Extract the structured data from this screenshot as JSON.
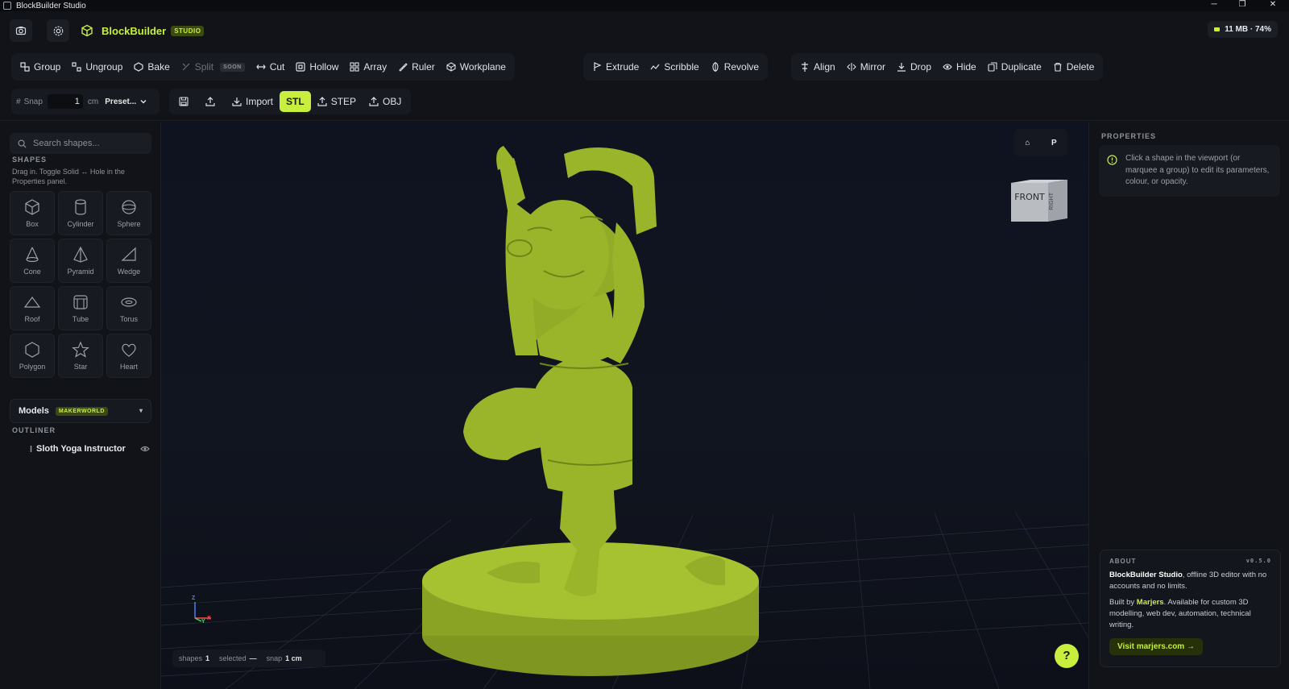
{
  "window": {
    "title": "BlockBuilder Studio",
    "controls": [
      "─",
      "❐",
      "✕"
    ]
  },
  "header": {
    "brand_name": "BlockBuilder",
    "brand_badge": "STUDIO",
    "memory": "11 MB · 74%",
    "accent_color": "#c8ef3e"
  },
  "toolbar": {
    "group1": [
      {
        "label": "Group",
        "icon": "group-icon"
      },
      {
        "label": "Ungroup",
        "icon": "ungroup-icon"
      },
      {
        "label": "Bake",
        "icon": "bake-icon"
      },
      {
        "label": "Split",
        "icon": "split-icon",
        "badge": "SOON",
        "disabled": true
      },
      {
        "label": "Cut",
        "icon": "cut-icon"
      },
      {
        "label": "Hollow",
        "icon": "hollow-icon"
      },
      {
        "label": "Array",
        "icon": "array-icon"
      },
      {
        "label": "Ruler",
        "icon": "ruler-icon"
      },
      {
        "label": "Workplane",
        "icon": "workplane-icon"
      }
    ],
    "group2": [
      {
        "label": "Extrude",
        "icon": "extrude-icon"
      },
      {
        "label": "Scribble",
        "icon": "scribble-icon"
      },
      {
        "label": "Revolve",
        "icon": "revolve-icon"
      }
    ],
    "group3": [
      {
        "label": "Align",
        "icon": "align-icon"
      },
      {
        "label": "Mirror",
        "icon": "mirror-icon"
      },
      {
        "label": "Drop",
        "icon": "drop-icon"
      },
      {
        "label": "Hide",
        "icon": "hide-icon"
      },
      {
        "label": "Duplicate",
        "icon": "duplicate-icon"
      },
      {
        "label": "Delete",
        "icon": "delete-icon"
      }
    ]
  },
  "snap": {
    "label": "Snap",
    "value": "1",
    "unit": "cm",
    "preset": "Preset..."
  },
  "file": {
    "import": "Import",
    "formats": [
      "STL",
      "STEP",
      "OBJ"
    ],
    "active_format": "STL"
  },
  "sidebar": {
    "search_placeholder": "Search shapes...",
    "shapes_title": "SHAPES",
    "shapes_hint": "Drag in. Toggle Solid ↔ Hole in the Properties panel.",
    "shapes": [
      {
        "label": "Box",
        "icon": "box-icon"
      },
      {
        "label": "Cylinder",
        "icon": "cylinder-icon"
      },
      {
        "label": "Sphere",
        "icon": "sphere-icon"
      },
      {
        "label": "Cone",
        "icon": "cone-icon"
      },
      {
        "label": "Pyramid",
        "icon": "pyramid-icon"
      },
      {
        "label": "Wedge",
        "icon": "wedge-icon"
      },
      {
        "label": "Roof",
        "icon": "roof-icon"
      },
      {
        "label": "Tube",
        "icon": "tube-icon"
      },
      {
        "label": "Torus",
        "icon": "torus-icon"
      },
      {
        "label": "Polygon",
        "icon": "polygon-icon"
      },
      {
        "label": "Star",
        "icon": "star-icon"
      },
      {
        "label": "Heart",
        "icon": "heart-icon"
      }
    ],
    "models_label": "Models",
    "models_badge": "MAKERWORLD",
    "outliner_title": "OUTLINER",
    "outliner_items": [
      "Sloth Yoga Instructor"
    ]
  },
  "viewport": {
    "home_label": "⌂",
    "projection_label": "P",
    "cube_front": "FRONT",
    "cube_right": "RIGHT",
    "axis_z": "Z",
    "axis_y": "Y",
    "axis_x": "X",
    "model_color": "#9bb52a",
    "status": {
      "shapes_label": "shapes",
      "shapes_value": "1",
      "selected_label": "selected",
      "selected_value": "—",
      "snap_label": "snap",
      "snap_value": "1 cm"
    },
    "help_label": "?"
  },
  "properties": {
    "title": "PROPERTIES",
    "hint": "Click a shape in the viewport (or marquee a group) to edit its parameters, colour, or opacity."
  },
  "about": {
    "title": "ABOUT",
    "version": "v0.5.0",
    "app_name": "BlockBuilder Studio",
    "description": ", offline 3D editor with no accounts and no limits.",
    "built_by_prefix": "Built by ",
    "author": "Marjers",
    "built_by_suffix": ". Available for custom 3D modelling, web dev, automation, technical writing.",
    "link_label": "Visit marjers.com →"
  }
}
